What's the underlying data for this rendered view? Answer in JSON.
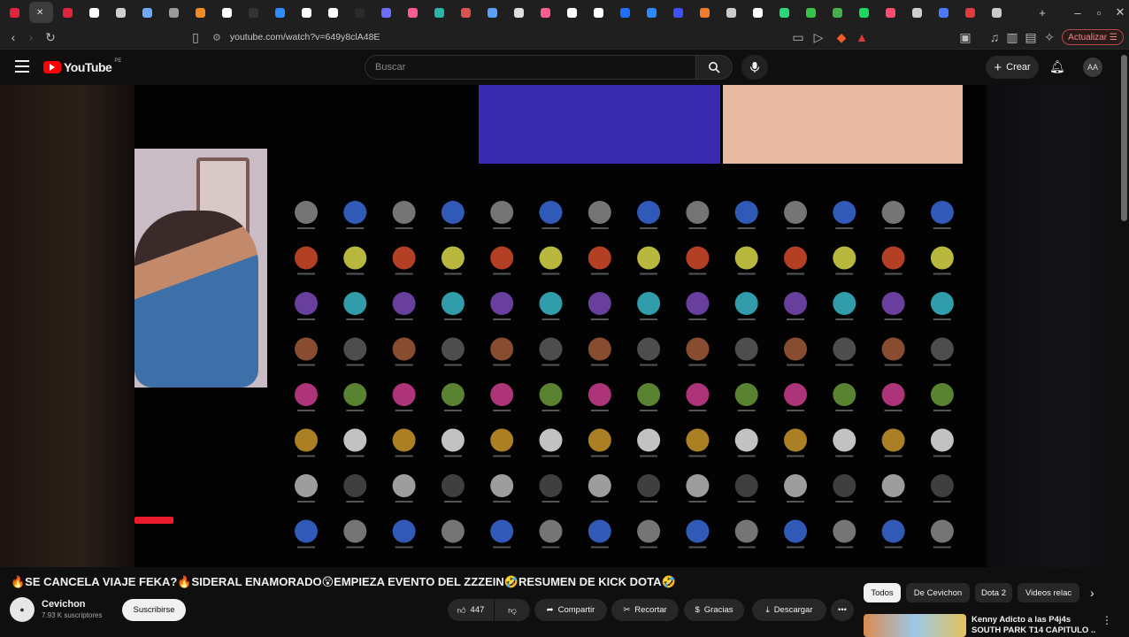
{
  "browser": {
    "url": "youtube.com/watch?v=649y8clA48E",
    "update_label": "Actualizar",
    "tab_colors": [
      "#e3223b",
      "#f0f0f0",
      "#e3223b",
      "#ffffff",
      "#cfcfcf",
      "#6fa8ff",
      "#9a9a9a",
      "#f08a24",
      "#ffffff",
      "#333333",
      "#2d8cff",
      "#ffffff",
      "#ffffff",
      "#2a2a2a",
      "#6c6cff",
      "#ff5d8f",
      "#2bb5a7",
      "#d9534f",
      "#5aa0ff",
      "#dddddd",
      "#ff5d8f",
      "#ffffff",
      "#ffffff",
      "#1e6fff",
      "#2b8aff",
      "#4050ff",
      "#f07c2a",
      "#cccccc",
      "#ffffff",
      "#2bd67b",
      "#37c24a",
      "#45b04a",
      "#1ed760",
      "#ff4d6d",
      "#cfcfcf",
      "#4a78ff",
      "#e03a3a",
      "#c9c9c9"
    ]
  },
  "youtube": {
    "logo": "YouTube",
    "region": "PE",
    "search_placeholder": "Buscar",
    "create_label": "Crear",
    "avatar_initials": "AA"
  },
  "video": {
    "title": "🔥SE CANCELA VIAJE FEKA?🔥SIDERAL ENAMORADO😲EMPIEZA EVENTO DEL ZZZEIN🤣RESUMEN DE KICK DOTA🤣"
  },
  "channel": {
    "name": "Cevichon",
    "subscribers": "7.93 K suscriptores",
    "subscribe_label": "Suscribirse"
  },
  "actions": {
    "likes": "447",
    "share": "Compartir",
    "clip": "Recortar",
    "thanks": "Gracias",
    "download": "Descargar"
  },
  "chips": [
    "Todos",
    "De Cevichon",
    "Dota 2",
    "Videos relac"
  ],
  "related": {
    "title_line1": "Kenny Adicto a las P4j4s",
    "title_line2": "SOUTH PARK T14 CAPITULO ..."
  }
}
